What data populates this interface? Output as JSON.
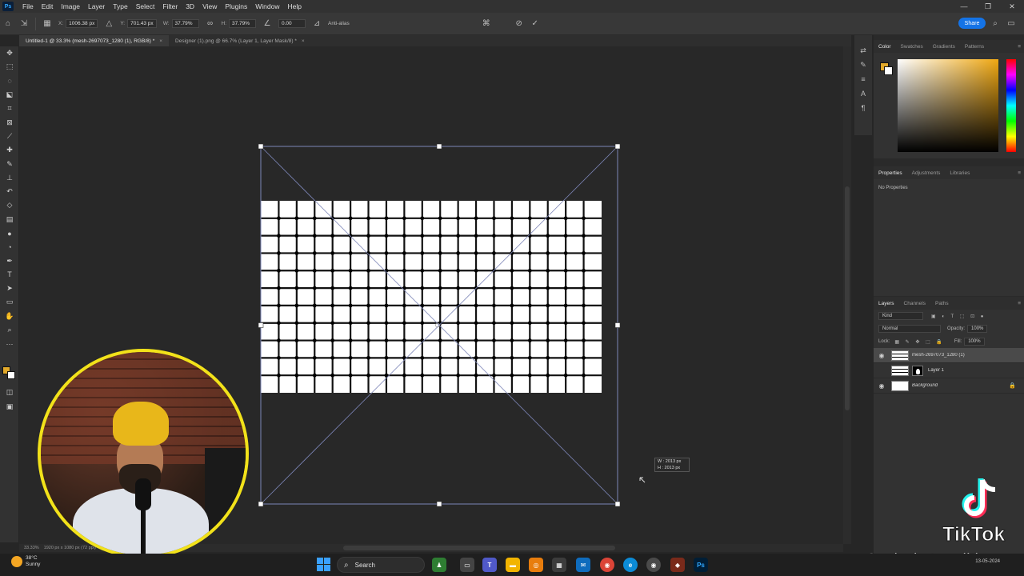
{
  "app": {
    "logo": "Ps",
    "menu": [
      "File",
      "Edit",
      "Image",
      "Layer",
      "Type",
      "Select",
      "Filter",
      "3D",
      "View",
      "Plugins",
      "Window",
      "Help"
    ],
    "window_controls": [
      "—",
      "❐",
      "✕"
    ]
  },
  "options": {
    "x_label": "X:",
    "x_value": "1006.38 px",
    "y_label": "Y:",
    "y_value": "701.43 px",
    "w_label": "W:",
    "w_value": "37.79%",
    "h_label": "H:",
    "h_value": "37.79%",
    "angle_value": "0.00",
    "antialias_label": "Anti-alias",
    "share_label": "Share"
  },
  "tabs": [
    {
      "label": "Untitled-1 @ 33.3% (mesh-2697073_1280 (1), RGB/8) *",
      "active": true
    },
    {
      "label": "Designer (1).png @ 66.7% (Layer 1, Layer Mask/8) *",
      "active": false
    }
  ],
  "canvas": {
    "tooltip_w": "W : 2013 px",
    "tooltip_h": "H : 2013 px",
    "status_zoom": "33.33%",
    "status_doc": "1920 px x 1080 px (72 ppi)"
  },
  "color_panel": {
    "tabs": [
      "Color",
      "Swatches",
      "Gradients",
      "Patterns"
    ],
    "foreground": "#e2a92a",
    "background": "#ffffff"
  },
  "properties_panel": {
    "tabs": [
      "Properties",
      "Adjustments",
      "Libraries"
    ],
    "empty_text": "No Properties"
  },
  "layers_panel": {
    "tabs": [
      "Layers",
      "Channels",
      "Paths"
    ],
    "search_placeholder": "Kind",
    "blend_mode": "Normal",
    "opacity_label": "Opacity:",
    "opacity_value": "100%",
    "lock_label": "Lock:",
    "fill_label": "Fill:",
    "fill_value": "100%",
    "layers": [
      {
        "name": "mesh-2697073_1280 (1)",
        "selected": true
      },
      {
        "name": "Layer 1",
        "selected": false
      },
      {
        "name": "Background",
        "selected": false
      }
    ]
  },
  "watermark": {
    "brand": "TikTok",
    "handle": "@ raj_photo_editing"
  },
  "taskbar": {
    "weather_temp": "38°C",
    "weather_desc": "Sunny",
    "search_label": "Search",
    "date": "13-05-2024"
  }
}
